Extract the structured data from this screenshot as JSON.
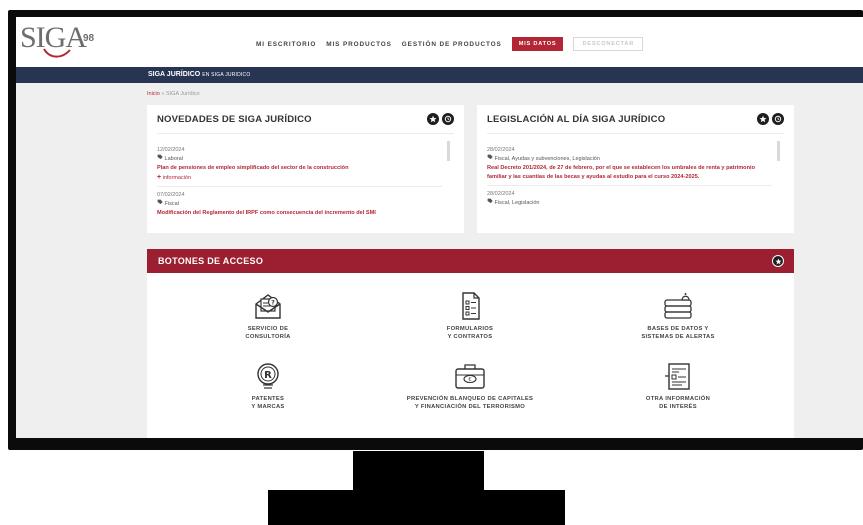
{
  "logo": {
    "text": "SIGA",
    "superscript": "98"
  },
  "nav": {
    "items": [
      "MI ESCRITORIO",
      "MIS PRODUCTOS",
      "GESTIÓN DE PRODUCTOS"
    ],
    "primary_button": "MIS DATOS",
    "outline_button": "DESCONECTAR"
  },
  "section": {
    "title_bold": "SIGA JURÍDICO",
    "title_suffix": "EN SIGA JURIDICO"
  },
  "breadcrumb": {
    "home": "Inicio",
    "separator": "»",
    "current": "SIGA Jurídico"
  },
  "novedades": {
    "title": "NOVEDADES DE SIGA JURÍDICO",
    "items": [
      {
        "date": "12/02/2024",
        "category": "Laboral",
        "title": "Plan de pensiones de empleo simplificado del sector de la construcción",
        "more": "información"
      },
      {
        "date": "07/02/2024",
        "category": "Fiscal",
        "title": "Modificación del Reglamento del IRPF como consecuencia del incremento del SMI"
      }
    ]
  },
  "legislacion": {
    "title": "LEGISLACIÓN AL DÍA SIGA JURÍDICO",
    "items": [
      {
        "date": "28/02/2024",
        "category": "Fiscal, Ayudas y subvenciones, Legislación",
        "title": "Real Decreto 201/2024, de 27 de febrero, por el que se establecen los umbrales de renta y patrimonio familiar y las cuantías de las becas y ayudas al estudio para el curso 2024-2025."
      },
      {
        "date": "28/02/2024",
        "category": "Fiscal, Legislación"
      }
    ]
  },
  "access": {
    "title": "BOTONES DE ACCESO",
    "tiles": [
      {
        "line1": "SERVICIO DE",
        "line2": "CONSULTORÍA",
        "icon": "envelope-question-icon"
      },
      {
        "line1": "FORMULARIOS",
        "line2": "Y CONTRATOS",
        "icon": "form-document-icon"
      },
      {
        "line1": "BASES DE DATOS Y",
        "line2": "SISTEMAS DE ALERTAS",
        "icon": "database-bell-icon"
      },
      {
        "line1": "PATENTES",
        "line2": "Y MARCAS",
        "icon": "registered-badge-icon"
      },
      {
        "line1": "PREVENCIÓN BLANQUEO DE CAPITALES",
        "line2": "Y FINANCIACIÓN DEL TERRORISMO",
        "icon": "briefcase-money-icon"
      },
      {
        "line1": "OTRA INFORMACIÓN",
        "line2": "DE INTERÉS",
        "icon": "info-document-icon"
      }
    ]
  },
  "colors": {
    "brand_red": "#9c1f31",
    "accent_red": "#b32635",
    "navy": "#283552"
  }
}
